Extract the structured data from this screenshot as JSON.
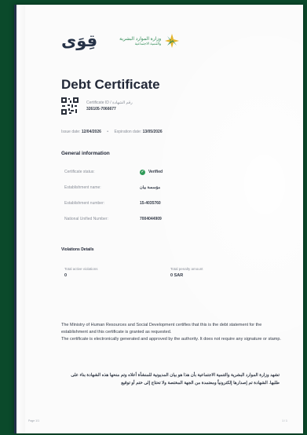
{
  "logos": {
    "qiwa": "قِوَى",
    "mhrsd_ar": "وزارة الموارد البشرية",
    "mhrsd_en": "والتنمية الاجتماعية"
  },
  "title": "Debt Certificate",
  "certificate": {
    "label": "Certificate ID / رقم الشهادة",
    "value": "326105-7066677"
  },
  "dates": {
    "issue_label": "Issue date:",
    "issue_value": "12/04/2026",
    "expiration_label": "Expiration date:",
    "expiration_value": "13/05/2026"
  },
  "general": {
    "title": "General information",
    "rows": [
      {
        "label": "Certificate status:",
        "value": "Verified"
      },
      {
        "label": "Establishment name:",
        "value": "مؤسسة بيان"
      },
      {
        "label": "Establishment number:",
        "value": "15-4035760"
      },
      {
        "label": "National Unified Number:",
        "value": "7004044909"
      }
    ]
  },
  "violations": {
    "title": "Violations Details",
    "active_label": "Total active violations",
    "active_value": "0",
    "penalty_label": "Total penalty amount",
    "penalty_value": "0 SAR"
  },
  "note_en_1": "The Ministry of Human Resources and Social Development certifies that this is the debt statement for the establishment and this certificate is granted as requested.",
  "note_en_2": "The certificate is electronically generated and approved by the authority. It does not require any signature or stamp.",
  "note_ar": "تشهد وزارة الموارد البشرية والتنمية الاجتماعية بأن هذا هو بيان المديونية للمنشأة أعلاه وتم منحها هذه الشهادة بناء على طلبها. الشهادة تم إصدارها إلكترونياً ومعتمدة من الجهة المختصة ولا تحتاج إلى ختم أو توقيع",
  "footer": {
    "left": "Page 1/1",
    "right": "1 / 1"
  },
  "colors": {
    "background": "#0b4a2b",
    "paper": "#fbfbfb",
    "verified": "#2f9a58",
    "logo_green": "#2f8a55",
    "logo_yellow": "#e3b52c"
  }
}
